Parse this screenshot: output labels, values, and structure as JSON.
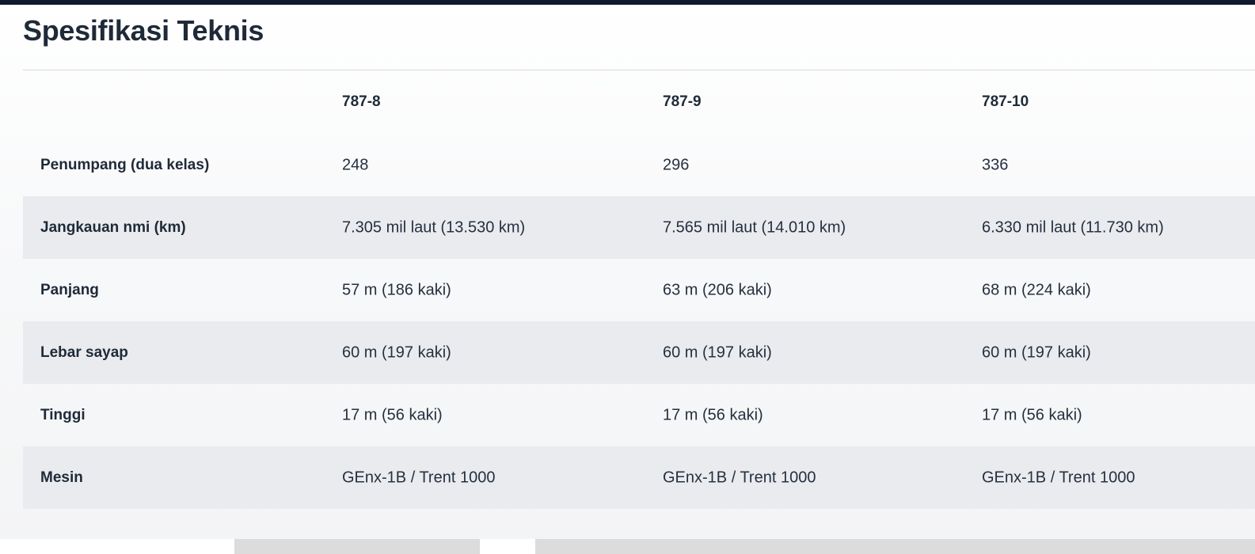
{
  "section": {
    "title": "Spesifikasi Teknis"
  },
  "table": {
    "columns": [
      "",
      "787-8",
      "787-9",
      "787-10"
    ],
    "rows": [
      {
        "label": "Penumpang (dua kelas)",
        "values": [
          "248",
          "296",
          "336"
        ]
      },
      {
        "label": "Jangkauan nmi (km)",
        "values": [
          "7.305 mil laut (13.530 km)",
          "7.565 mil laut (14.010 km)",
          "6.330 mil laut (11.730 km)"
        ]
      },
      {
        "label": "Panjang",
        "values": [
          "57 m (186 kaki)",
          "63 m (206 kaki)",
          "68 m (224 kaki)"
        ]
      },
      {
        "label": "Lebar sayap",
        "values": [
          "60 m (197 kaki)",
          "60 m (197 kaki)",
          "60 m (197 kaki)"
        ]
      },
      {
        "label": "Tinggi",
        "values": [
          "17 m (56 kaki)",
          "17 m (56 kaki)",
          "17 m (56 kaki)"
        ]
      },
      {
        "label": "Mesin",
        "values": [
          "GEnx-1B / Trent 1000",
          "GEnx-1B / Trent 1000",
          "GEnx-1B / Trent 1000"
        ]
      }
    ]
  },
  "colors": {
    "top_bar": "#0f1a2e",
    "row_shade": "#e9ebee",
    "text": "#1f2a38"
  }
}
